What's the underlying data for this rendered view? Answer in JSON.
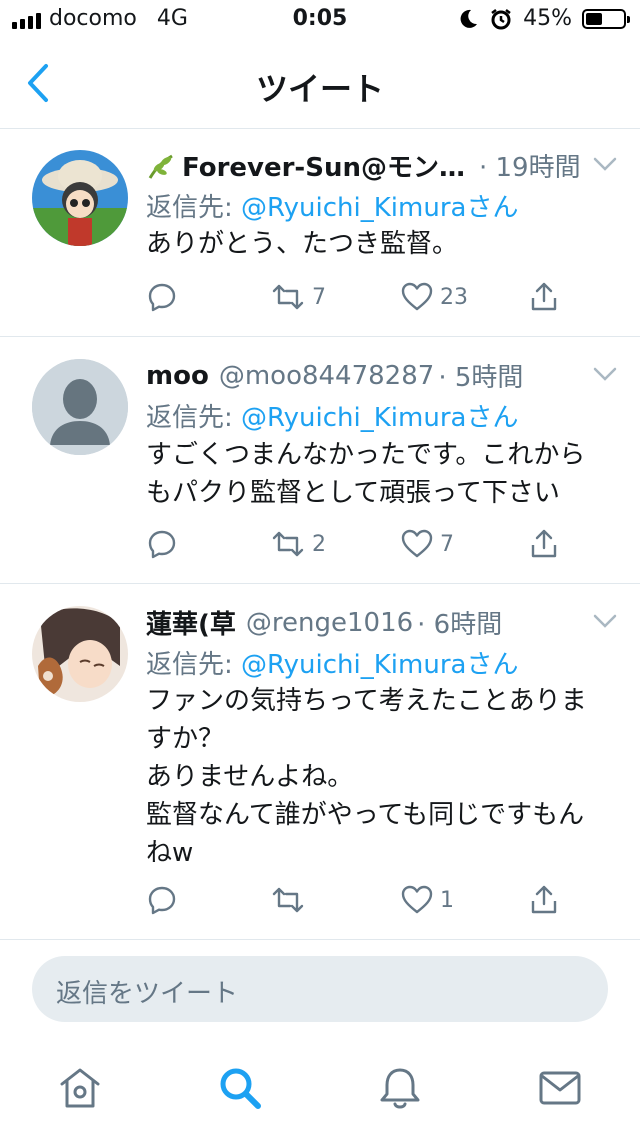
{
  "status_bar": {
    "carrier": "docomo",
    "network": "4G",
    "time": "0:05",
    "battery": "45%",
    "battery_level": 0.45
  },
  "nav": {
    "title": "ツイート"
  },
  "tweets": [
    {
      "name": "Forever-Sun@モン…",
      "name_icon": "leaf-emoji",
      "handle": "",
      "time": "· 19時間",
      "reply_prefix": "返信先: ",
      "reply_mention": "@Ryuichi_Kimuraさん",
      "text": "ありがとう、たつき監督。",
      "replies": "",
      "retweets": "7",
      "likes": "23"
    },
    {
      "name": "moo",
      "handle": "@moo84478287",
      "time": "· 5時間",
      "reply_prefix": "返信先: ",
      "reply_mention": "@Ryuichi_Kimuraさん",
      "text": "すごくつまんなかったです。これから\nもパクり監督として頑張って下さい",
      "replies": "",
      "retweets": "2",
      "likes": "7"
    },
    {
      "name": "蓮華(草",
      "handle": "@renge1016",
      "time": "· 6時間",
      "reply_prefix": "返信先: ",
      "reply_mention": "@Ryuichi_Kimuraさん",
      "text": "ファンの気持ちって考えたことありま\nすか？\nありませんよね。\n監督なんて誰がやっても同じですもん\nねw",
      "replies": "",
      "retweets": "",
      "likes": "1"
    }
  ],
  "reply_box": {
    "placeholder": "返信をツイート"
  },
  "tabbar": {
    "items": [
      "home-icon",
      "search-icon",
      "notifications-icon",
      "messages-icon"
    ],
    "active": "search-icon"
  },
  "colors": {
    "accent": "#1da1f2",
    "muted": "#657786",
    "text": "#14171a",
    "divider": "#e1e8ed"
  }
}
